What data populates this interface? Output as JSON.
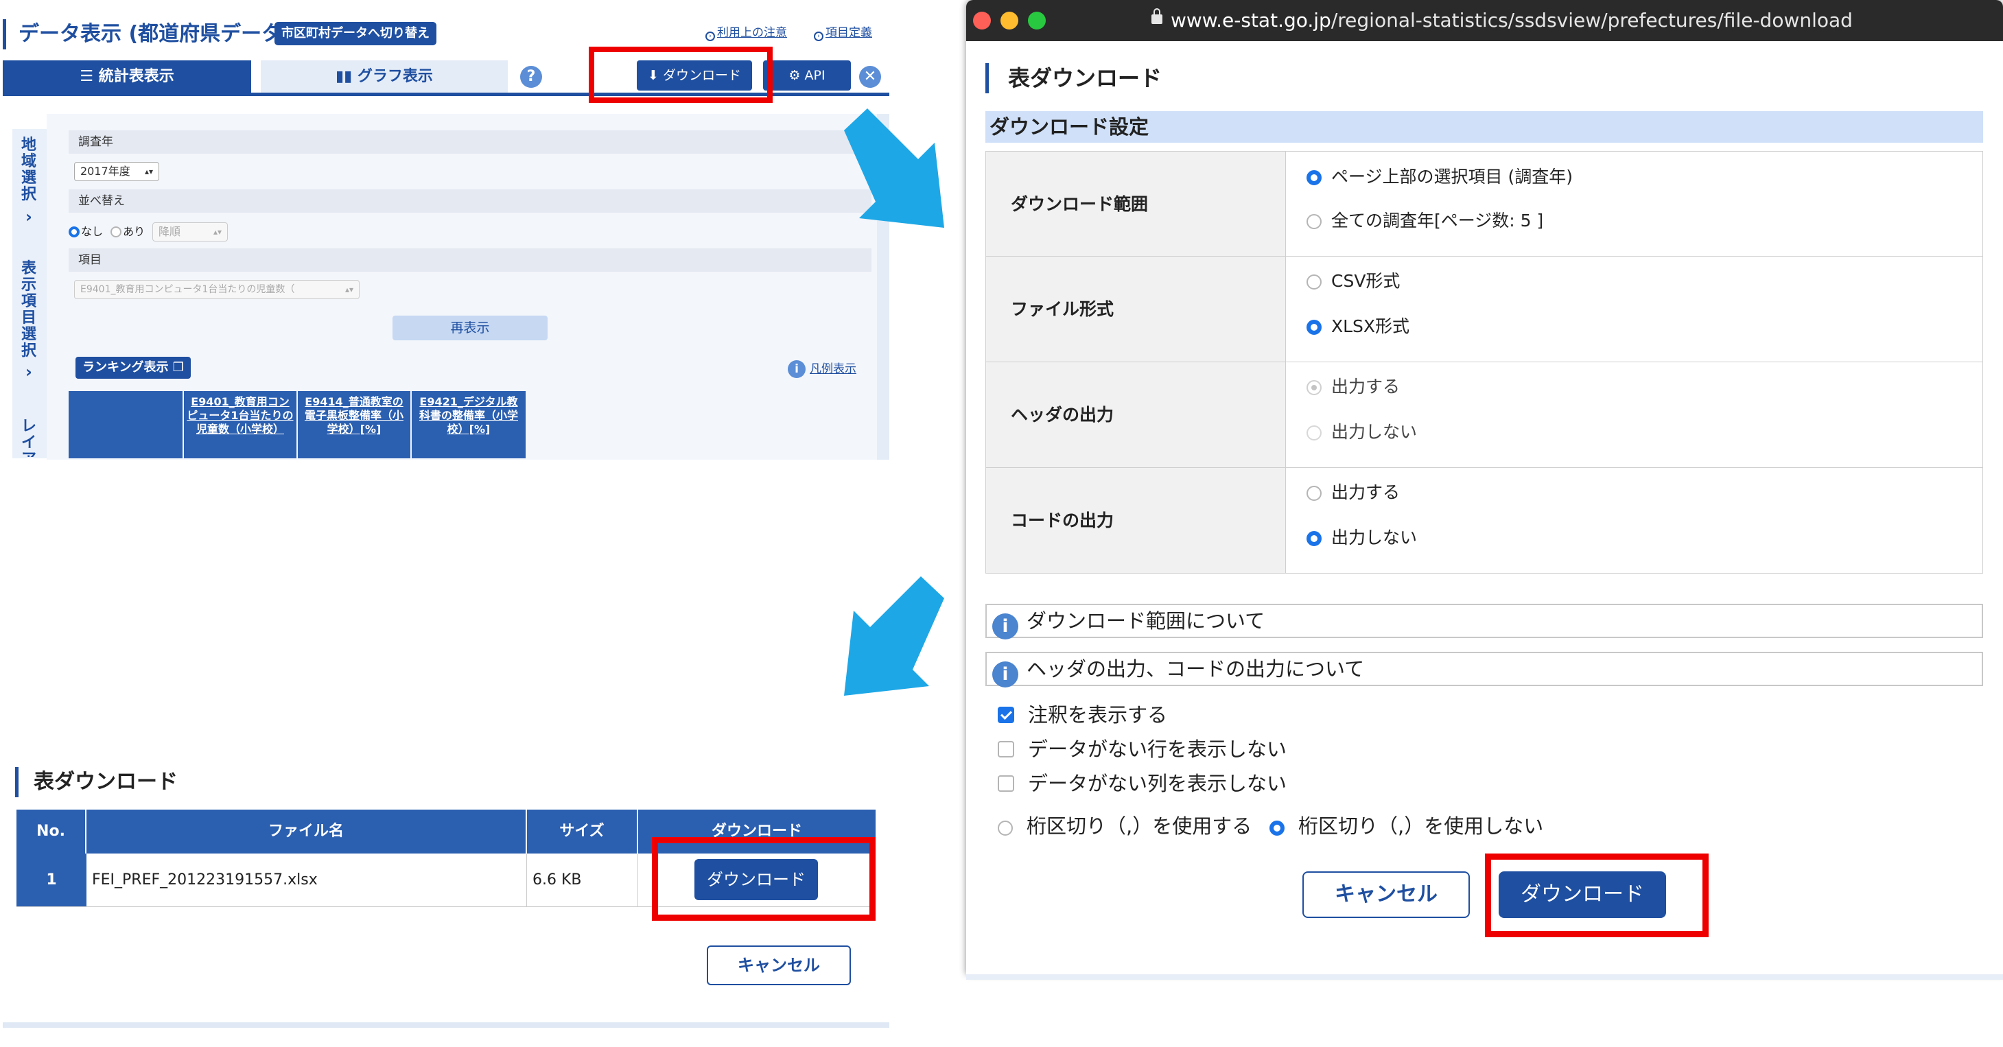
{
  "panel1": {
    "title": "データ表示 (都道府県データ)",
    "switch_label": "市区町村データへ切り替え",
    "link_usage": "利用上の注意",
    "link_definitions": "項目定義",
    "tab_table": "統計表表示",
    "tab_graph": "グラフ表示",
    "help": "?",
    "download_button": "ダウンロード",
    "api_button": "API",
    "side_region": "地域選択",
    "side_items": "表示項目選択",
    "side_layout": "レイア",
    "label_year": "調査年",
    "year_value": "2017年度",
    "label_sort": "並べ替え",
    "sort_none": "なし",
    "sort_yes": "あり",
    "sort_order": "降順",
    "label_item": "項目",
    "item_value": "E9401_教育用コンピュータ1台当たりの児童数（",
    "rerun_button": "再表示",
    "ranking_button": "ランキング表示",
    "legend_link": "凡例表示",
    "legend_icon": "i",
    "columns": [
      "E9401_教育用コンピュータ1台当たりの児童数（小学校）",
      "E9414_普通教室の電子黒板整備率（小学校）[%]",
      "E9421_デジタル教科書の整備率（小学校）[%]"
    ]
  },
  "panel2": {
    "url_host": "www.e-stat.go.jp",
    "url_path": "/regional-statistics/ssdsview/prefectures/file-download",
    "title": "表ダウンロード",
    "section": "ダウンロード設定",
    "range_label": "ダウンロード範囲",
    "range_opt1": "ページ上部の選択項目 (調査年)",
    "range_opt2": "全ての調査年[ページ数: 5 ]",
    "format_label": "ファイル形式",
    "format_csv": "CSV形式",
    "format_xlsx": "XLSX形式",
    "header_label": "ヘッダの出力",
    "header_yes": "出力する",
    "header_no": "出力しない",
    "code_label": "コードの出力",
    "code_yes": "出力する",
    "code_no": "出力しない",
    "info_range": "ダウンロード範囲について",
    "info_header": "ヘッダの出力、コードの出力について",
    "info_icon": "i",
    "chk_notes": "注釈を表示する",
    "chk_rows": "データがない行を表示しない",
    "chk_cols": "データがない列を表示しない",
    "sep_use": "桁区切り（,）を使用する",
    "sep_nouse": "桁区切り（,）を使用しない",
    "cancel": "キャンセル",
    "download": "ダウンロード"
  },
  "panel3": {
    "title": "表ダウンロード",
    "col_no": "No.",
    "col_filename": "ファイル名",
    "col_size": "サイズ",
    "col_download": "ダウンロード",
    "row_no": "1",
    "row_filename": "FEI_PREF_201223191557.xlsx",
    "row_size": "6.6 KB",
    "row_download": "ダウンロード",
    "cancel": "キャンセル"
  },
  "colors": {
    "brand_navy": "#1f4fa0",
    "header_blue": "#2b5fb0",
    "highlight_red": "#ee0000",
    "arrow_blue": "#1ea7e6",
    "radio_blue": "#1a73e8"
  }
}
